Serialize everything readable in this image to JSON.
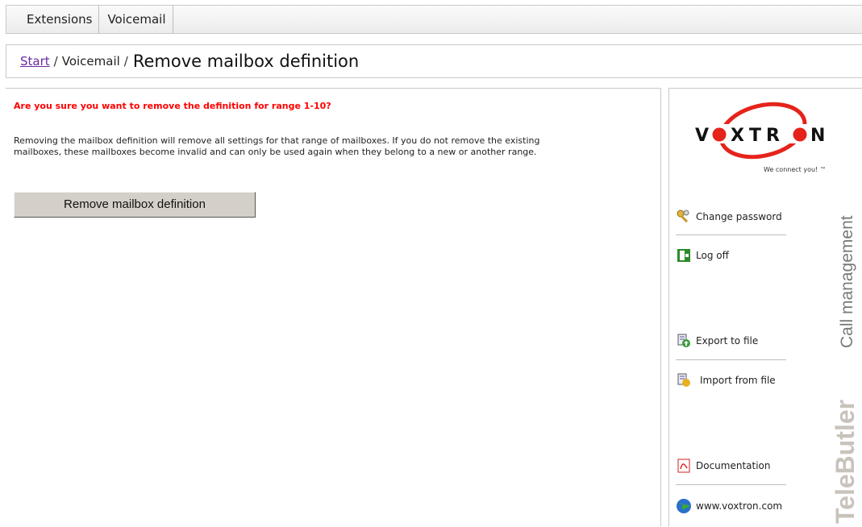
{
  "tabs": [
    {
      "label": "Extensions"
    },
    {
      "label": "Voicemail"
    }
  ],
  "breadcrumb": {
    "start": "Start",
    "separator": "/",
    "section": "Voicemail",
    "title": "Remove mailbox definition"
  },
  "main": {
    "warning": "Are you sure you want to remove the definition for range 1-10?",
    "description": "Removing the mailbox definition will remove all settings for that range of mailboxes. If you do not remove the existing mailboxes, these mailboxes become invalid and can only be used again when they belong to a new or another range.",
    "button_label": "Remove mailbox definition"
  },
  "sidebar": {
    "logo_text": "VOXTRON",
    "tagline": "We connect you! ™",
    "vertical_brand": "TeleButler",
    "vertical_sub": "Call management",
    "items": [
      {
        "label": "Change password",
        "icon": "key-icon"
      },
      {
        "label": "Log off",
        "icon": "exit-door-icon"
      },
      {
        "label": "Export to file",
        "icon": "export-icon"
      },
      {
        "label": "Import from file",
        "icon": "import-icon"
      },
      {
        "label": "Documentation",
        "icon": "pdf-icon"
      },
      {
        "label": "www.voxtron.com",
        "icon": "globe-icon"
      }
    ]
  },
  "colors": {
    "warning": "#ff0000",
    "link": "#6b2aa5",
    "logo_red": "#e5231b",
    "brand_gray": "#c8c3bb"
  }
}
